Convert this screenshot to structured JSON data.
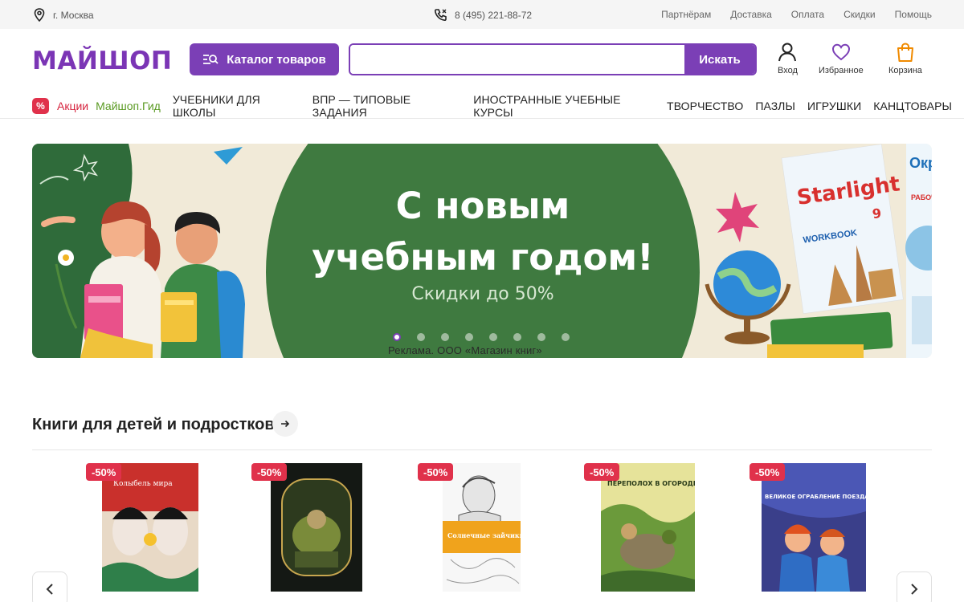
{
  "topbar": {
    "city": "г. Москва",
    "phone": "8 (495) 221-88-72",
    "links": [
      "Партнёрам",
      "Доставка",
      "Оплата",
      "Скидки",
      "Помощь"
    ]
  },
  "header": {
    "logo": "МАЙШОП",
    "catalog_label": "Каталог товаров",
    "search_placeholder": "",
    "search_button": "Искать",
    "login_label": "Вход",
    "favorites_label": "Избранное",
    "cart_label": "Корзина"
  },
  "nav": {
    "percent_badge": "%",
    "promo": "Акции",
    "guide": "Майшоп.Гид",
    "categories": [
      "УЧЕБНИКИ ДЛЯ ШКОЛЫ",
      "ВПР — ТИПОВЫЕ ЗАДАНИЯ",
      "ИНОСТРАННЫЕ УЧЕБНЫЕ КУРСЫ",
      "ТВОРЧЕСТВО",
      "ПАЗЛЫ",
      "ИГРУШКИ",
      "КАНЦТОВАРЫ"
    ]
  },
  "banner": {
    "title_line1": "С новым",
    "title_line2": "учебным годом!",
    "subtitle": "Скидки до 50%",
    "ad_text": "Реклама. ООО «Магазин книг»",
    "slide_count": 8,
    "active_slide": 1,
    "book1_title": "Starlight",
    "book1_number": "9",
    "book1_subtitle": "WORKBOOK",
    "book2_title": "Окруж МИ",
    "book2_subtitle": "РАБОЧАЯ Т"
  },
  "section": {
    "title": "Книги для детей и подростков"
  },
  "books": [
    {
      "discount": "-50%",
      "cover_text": "Колыбель мира"
    },
    {
      "discount": "-50%",
      "cover_text": ""
    },
    {
      "discount": "-50%",
      "cover_text": "Солнечные зайчики"
    },
    {
      "discount": "-50%",
      "cover_text": "ПЕРЕПОЛОХ В ОГОРОДЕ"
    },
    {
      "discount": "-50%",
      "cover_text": "ВЕЛИКОЕ ОГРАБЛЕНИЕ ПОЕЗДА"
    }
  ],
  "colors": {
    "brand_purple": "#7b3fb6",
    "sale_red": "#e0314b",
    "banner_green": "#3f7a40"
  }
}
